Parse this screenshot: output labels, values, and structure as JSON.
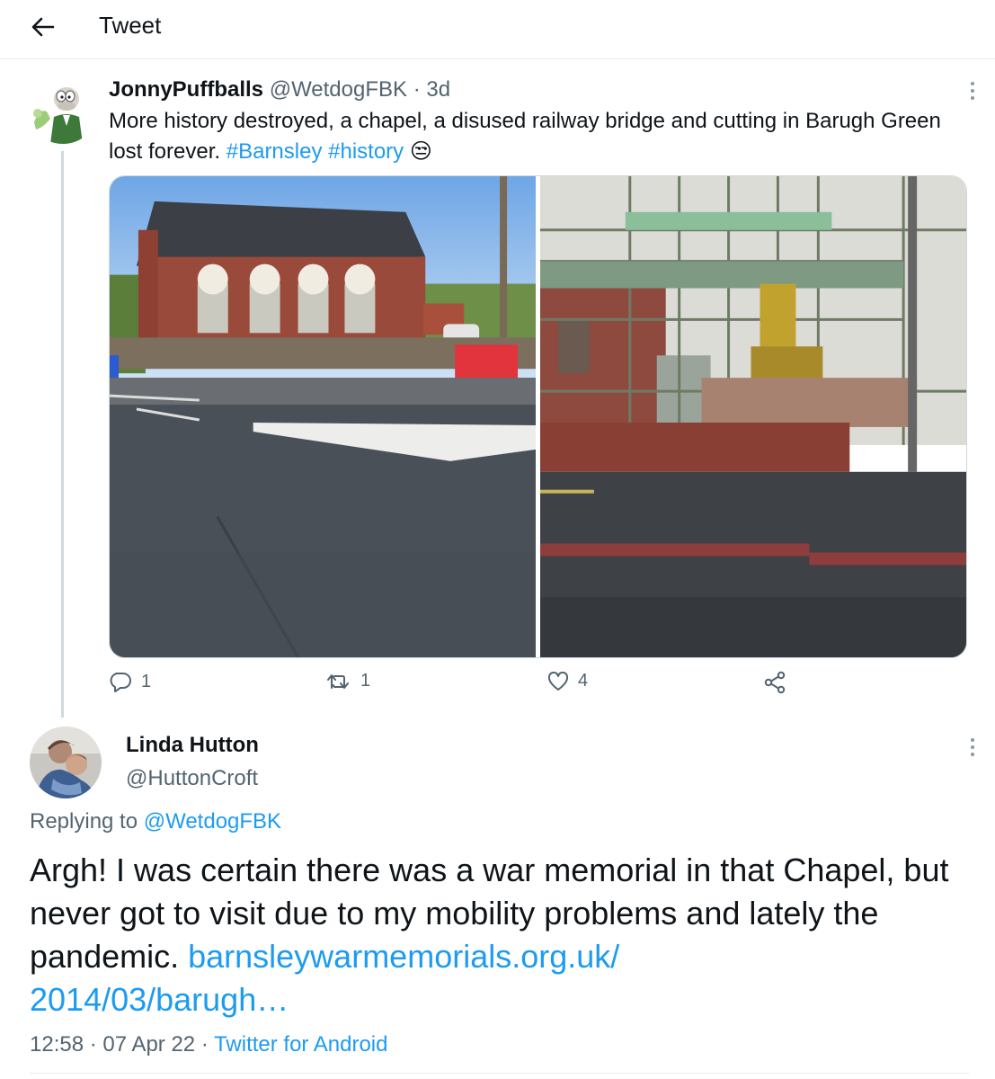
{
  "header": {
    "title": "Tweet",
    "back_icon": "arrow-left-icon"
  },
  "tweet": {
    "name": "JonnyPuffballs",
    "handle": "@WetdogFBK",
    "separator": "·",
    "age": "3d",
    "text_plain": "More history destroyed, a chapel, a disused railway bridge and cutting in Barugh Green lost forever. ",
    "hashtag1": "#Barnsley",
    "hashtag2": "#history",
    "emoji": "😒",
    "actions": {
      "replies": "1",
      "retweets": "1",
      "likes": "4"
    }
  },
  "reply": {
    "name": "Linda Hutton",
    "handle": "@HuttonCroft",
    "replying_label": "Replying to",
    "replying_to": "@WetdogFBK",
    "text": "Argh! I was certain there was a war memorial in that Chapel, but never got to visit due to my mobility problems and lately the pandemic. ",
    "link_line1": "barnsleywarmemorials.org.uk/",
    "link_line2": "2014/03/barugh…",
    "time": "12:58",
    "date": "07 Apr 22",
    "separator": "·",
    "client": "Twitter for Android"
  },
  "colors": {
    "link": "#1d9bf0",
    "secondary_text": "#536471",
    "divider": "#e6ecf0"
  }
}
